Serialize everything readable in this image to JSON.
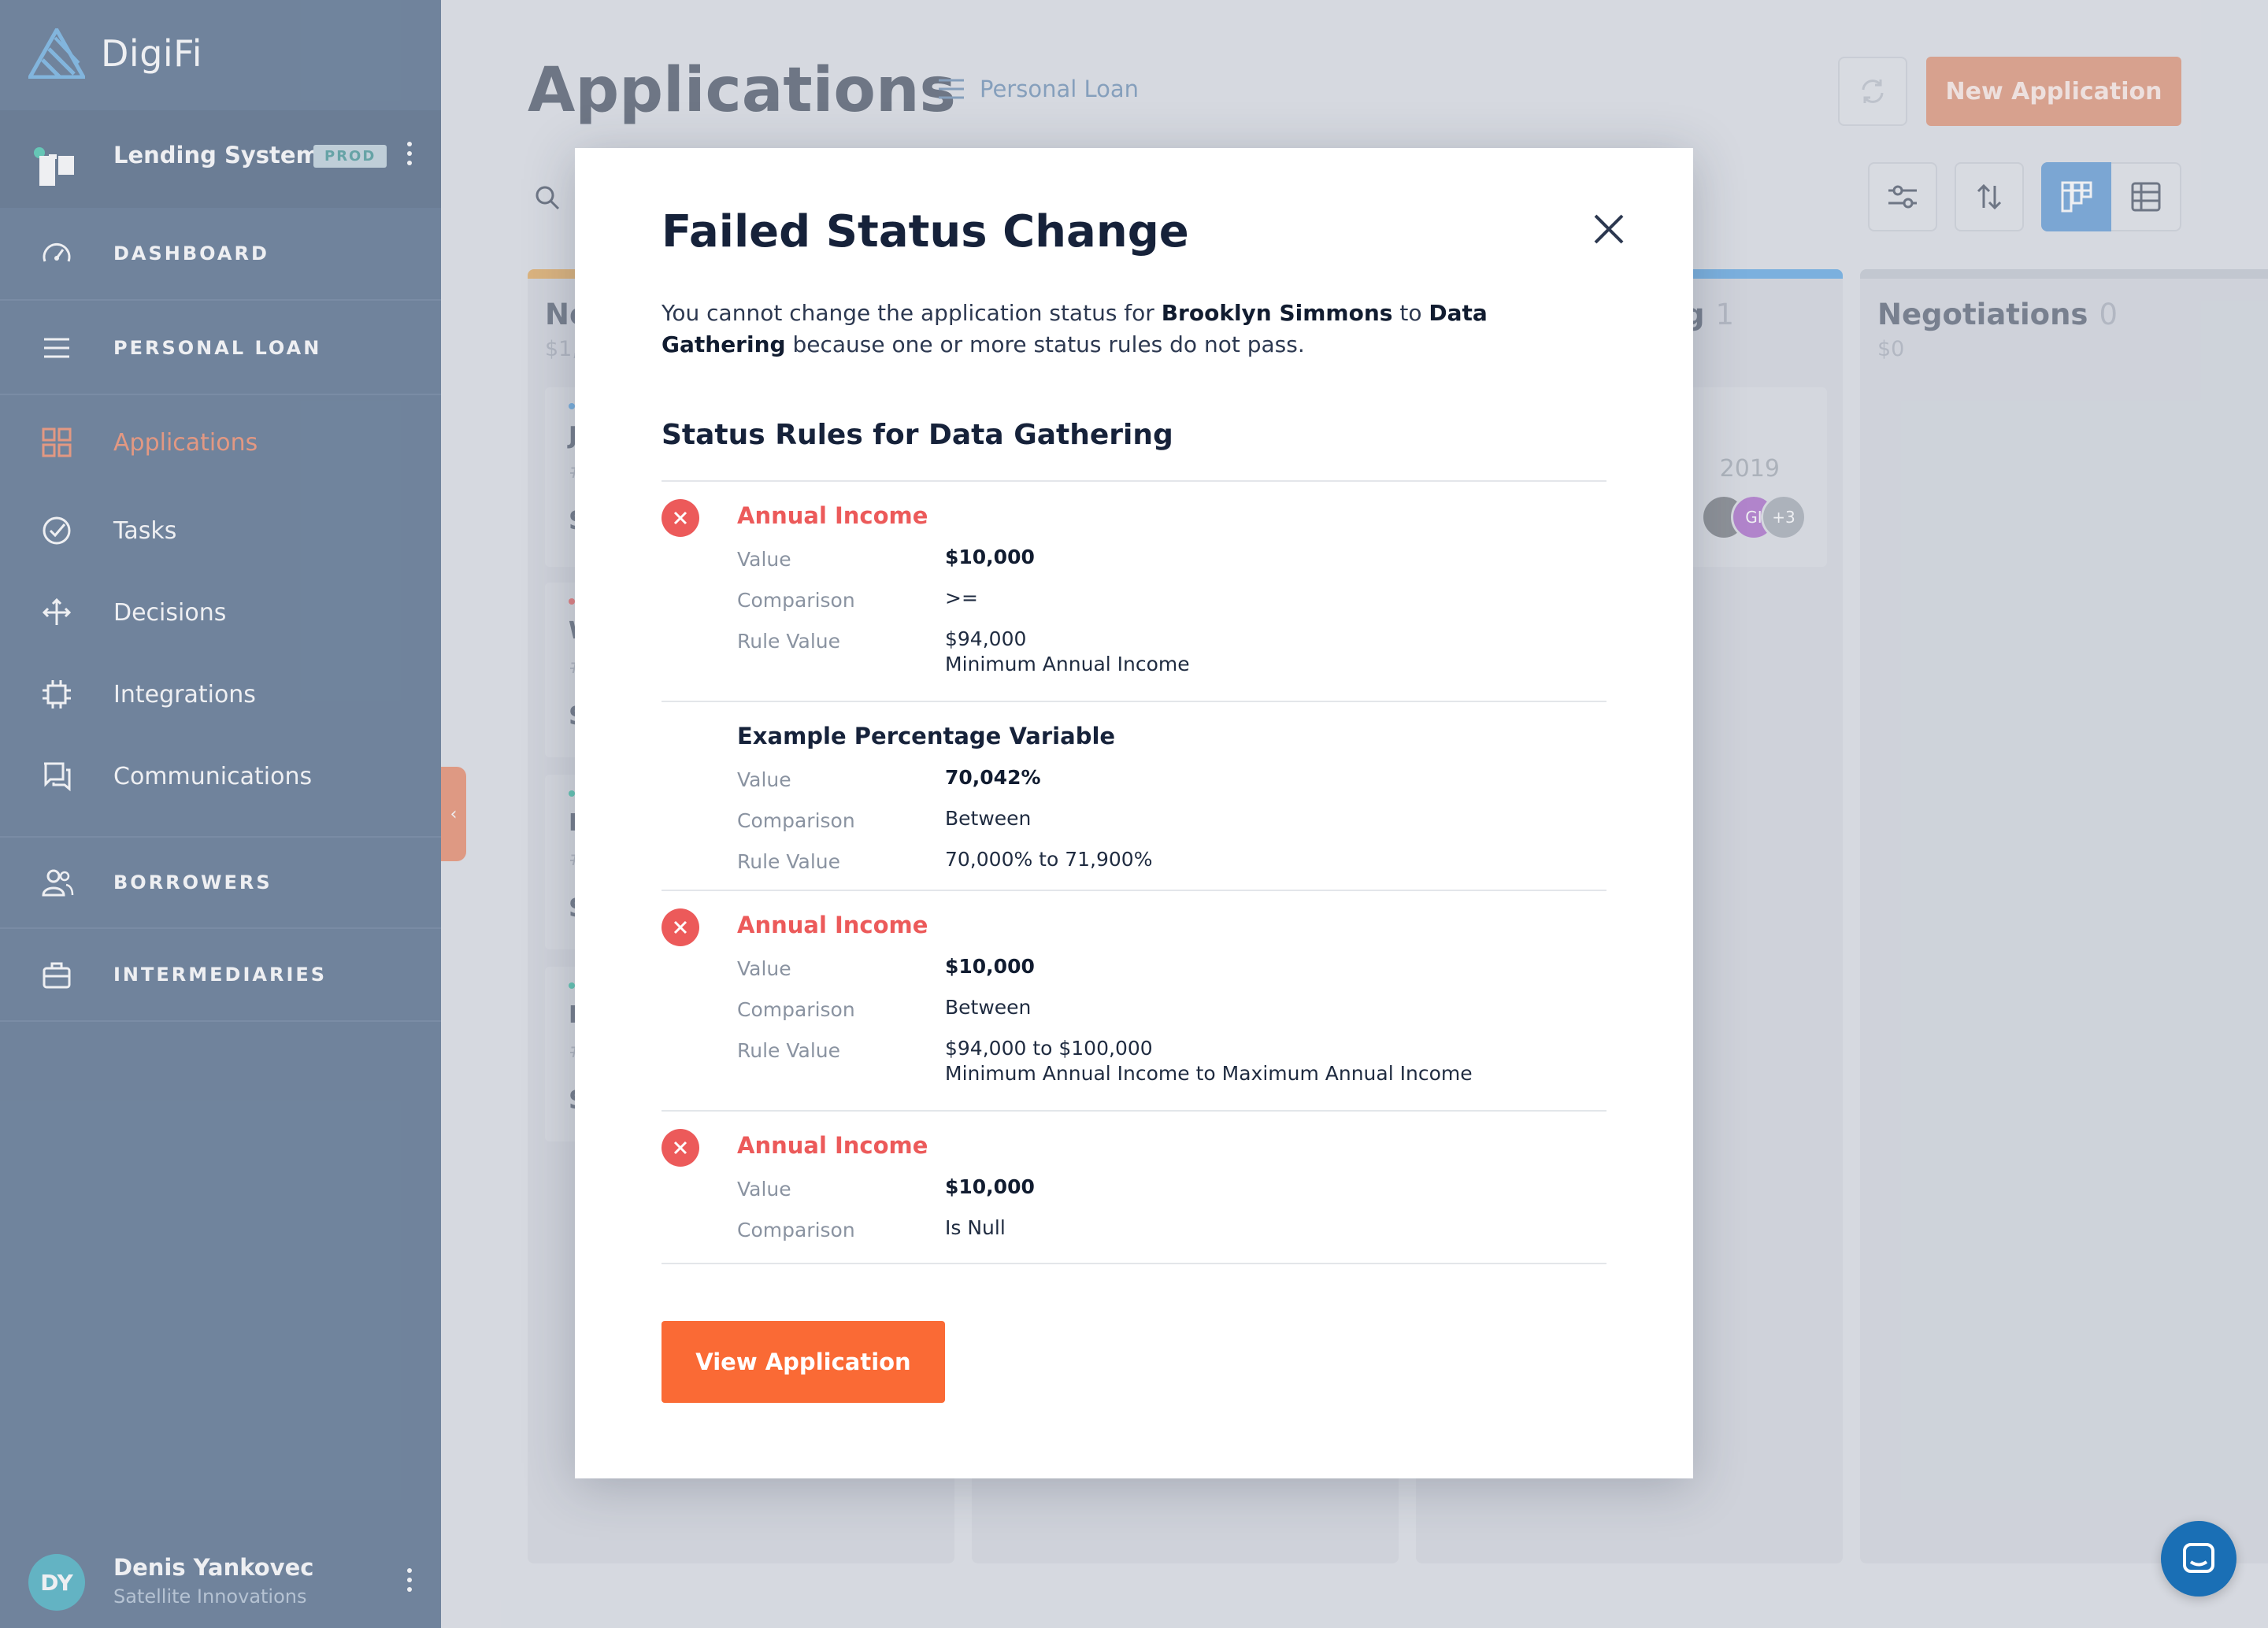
{
  "app": {
    "brand": "DigiFi"
  },
  "org": {
    "name": "Lending System",
    "env_badge": "PROD"
  },
  "sidebar": {
    "sections": [
      {
        "label": "DASHBOARD",
        "icon": "gauge-icon"
      },
      {
        "label": "PERSONAL LOAN",
        "icon": "menu-icon"
      }
    ],
    "items": [
      {
        "label": "Applications",
        "icon": "grid-icon",
        "active": true
      },
      {
        "label": "Tasks",
        "icon": "check-circle-icon"
      },
      {
        "label": "Decisions",
        "icon": "arrows-icon"
      },
      {
        "label": "Integrations",
        "icon": "chip-icon"
      },
      {
        "label": "Communications",
        "icon": "chat-icon"
      }
    ],
    "bottom_sections": [
      {
        "label": "BORROWERS",
        "icon": "users-icon"
      },
      {
        "label": "INTERMEDIARIES",
        "icon": "briefcase-icon"
      }
    ]
  },
  "user": {
    "initials": "DY",
    "name": "Denis Yankovec",
    "org": "Satellite Innovations"
  },
  "header": {
    "title": "Applications",
    "product": "Personal Loan",
    "new_button": "New Application"
  },
  "board": {
    "columns": [
      {
        "title": "Ne",
        "count": "",
        "sum": "$1,",
        "bar_color": "#e0a44f"
      },
      {
        "title": "",
        "count": "",
        "sum": "",
        "bar_color": "#cfd3da"
      },
      {
        "title": "g",
        "count": "1",
        "sum": "",
        "bar_color": "#4f9ee0"
      },
      {
        "title": "Negotiations",
        "count": "0",
        "sum": "$0",
        "bar_color": "#bcc2cb"
      }
    ],
    "card_fragments": [
      "J",
      "#",
      "S",
      "W",
      "#",
      "S",
      "E",
      "#",
      "S",
      "E",
      "#",
      "S"
    ],
    "visible_card_date": "2019",
    "avatar_initials": "GI",
    "avatar_more": "+3"
  },
  "modal": {
    "title": "Failed Status Change",
    "message_pre": "You cannot change the application status for ",
    "borrower": "Brooklyn Simmons",
    "message_mid": " to ",
    "target_status": "Data Gathering",
    "message_post": " because one or more status rules do not pass.",
    "rules_title": "Status Rules for Data Gathering",
    "labels": {
      "value": "Value",
      "comparison": "Comparison",
      "rule_value": "Rule Value"
    },
    "rules": [
      {
        "name": "Annual Income",
        "failed": true,
        "value": "$10,000",
        "comparison": ">=",
        "rule_value": "$94,000",
        "rule_value_note": "Minimum Annual Income"
      },
      {
        "name": "Example Percentage Variable",
        "failed": false,
        "value": "70,042%",
        "comparison": "Between",
        "rule_value": "70,000% to 71,900%",
        "rule_value_note": ""
      },
      {
        "name": "Annual Income",
        "failed": true,
        "value": "$10,000",
        "comparison": "Between",
        "rule_value": "$94,000 to $100,000",
        "rule_value_note": "Minimum Annual Income to Maximum Annual Income"
      },
      {
        "name": "Annual Income",
        "failed": true,
        "value": "$10,000",
        "comparison": "Is Null"
      }
    ],
    "action_button": "View Application"
  },
  "colors": {
    "sidebar": "#3e5a7c",
    "accent": "#fa6a35",
    "fail": "#ec5a5a",
    "primary": "#4f8fd0"
  }
}
